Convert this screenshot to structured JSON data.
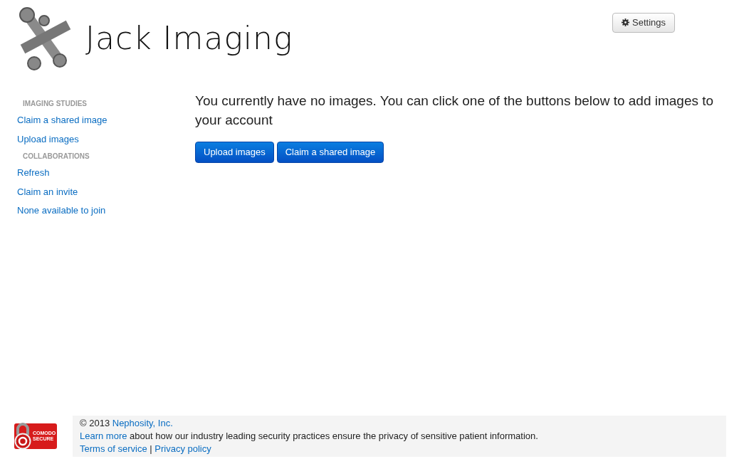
{
  "header": {
    "logo_text": "Jack Imaging",
    "settings_button": "Settings"
  },
  "sidebar": {
    "sections": [
      {
        "heading": "IMAGING STUDIES",
        "items": [
          "Claim a shared image",
          "Upload images"
        ]
      },
      {
        "heading": "COLLABORATIONS",
        "items": [
          "Refresh",
          "Claim an invite",
          "None available to join"
        ]
      }
    ]
  },
  "main": {
    "message": "You currently have no images. You can click one of the buttons below to add images to your account",
    "buttons": [
      "Upload images",
      "Claim a shared image"
    ]
  },
  "footer": {
    "badge": {
      "line1": "COMODO",
      "line2": "SECURE"
    },
    "copyright": "© 2013",
    "company_link": "Nephosity, Inc.",
    "learn_more_link": "Learn more",
    "security_text": "about how our industry leading security practices ensure the privacy of sensitive patient information.",
    "links": [
      "Terms of service",
      "Privacy policy"
    ],
    "separator": "|"
  }
}
